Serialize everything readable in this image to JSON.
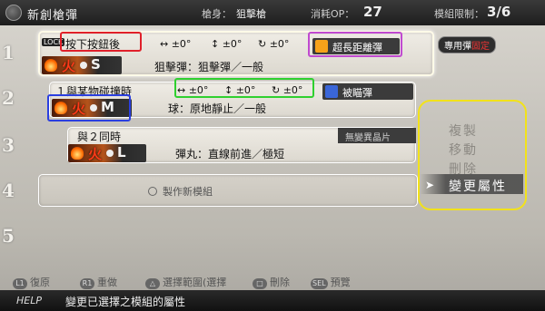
{
  "header": {
    "title": "新創槍彈",
    "gun_label": "槍身：",
    "gun_value": "狙擊槍",
    "op_label": "消耗OP：",
    "op_value": "27",
    "module_label": "模組限制：",
    "module_value": "3/6"
  },
  "rows": [
    "1",
    "2",
    "3",
    "4",
    "5"
  ],
  "modules": [
    {
      "lock_tag": "LOCK",
      "trigger": "按下按鈕後",
      "params": [
        "↔ ±0°",
        "↕ ±0°",
        "↻ ±0°"
      ],
      "element": "火",
      "size": "S",
      "bullet": "狙擊彈：狙擊彈／一般",
      "special": "超長距離彈",
      "dedicated_prefix": "專用彈",
      "dedicated_red": "固定"
    },
    {
      "trigger": "１與某物碰撞時",
      "params": [
        "↔ ±0°",
        "↕ ±0°",
        "↻ ±0°"
      ],
      "element": "火",
      "size": "M",
      "bullet": "球：原地靜止／一般",
      "special": "被瞄彈"
    },
    {
      "trigger": "與２同時",
      "element": "火",
      "size": "L",
      "bullet": "彈丸：直線前進／極短",
      "side_label": "無變異晶片"
    }
  ],
  "create_module": "製作新模組",
  "context_menu": {
    "items": [
      "複製",
      "移動",
      "刪除",
      "變更屬性"
    ],
    "selected": 3
  },
  "hints": [
    {
      "button": "L1",
      "label": "復原"
    },
    {
      "button": "R1",
      "label": "重做"
    },
    {
      "button": "△",
      "label": "選擇範圍(選擇"
    },
    {
      "button": "□",
      "label": "刪除"
    },
    {
      "button": "SEL",
      "label": "預覽"
    }
  ],
  "help": {
    "label": "HELP",
    "text": "變更已選擇之模組的屬性"
  },
  "colors": {
    "annotation_red": "#e0202a",
    "annotation_magenta": "#c04ad0",
    "annotation_green": "#2fd02f",
    "annotation_blue": "#2b3fe0",
    "annotation_yellow": "#f2e21a",
    "fire": "#ff3a18"
  }
}
